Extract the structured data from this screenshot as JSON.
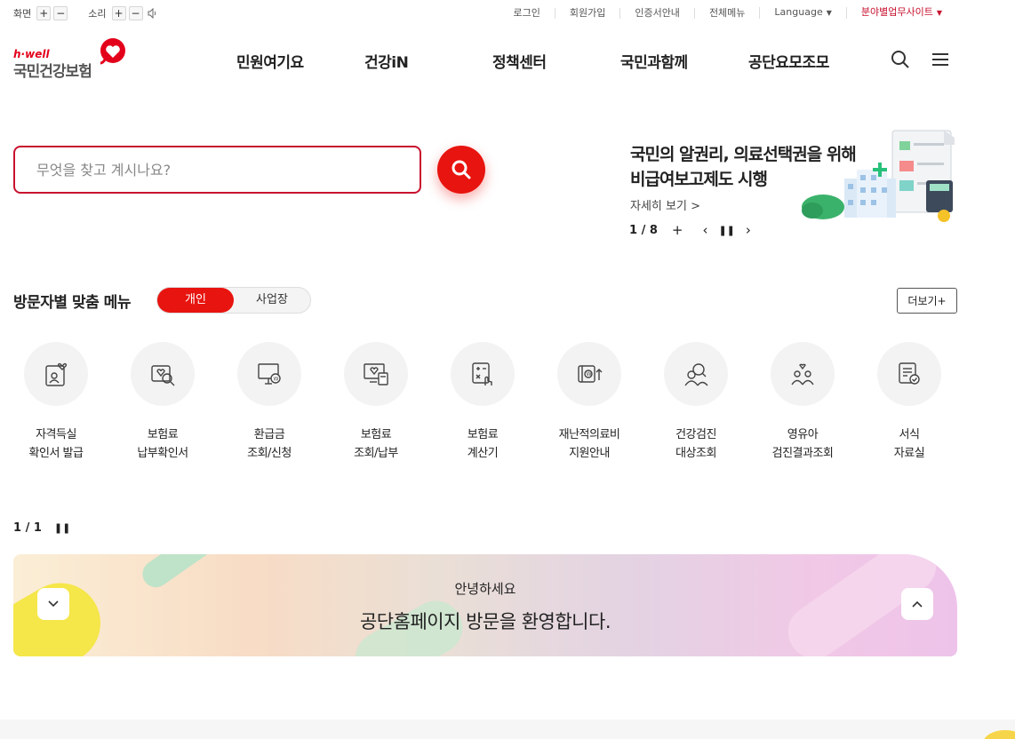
{
  "util": {
    "screen_label": "화면",
    "sound_label": "소리",
    "plus": "+",
    "minus": "−",
    "links": [
      "로그인",
      "회원가입",
      "인증서안내",
      "전체메뉴"
    ],
    "language": "Language",
    "field_site": "분야별업무사이트"
  },
  "logo": {
    "brand": "h·well",
    "name": "국민건강보험"
  },
  "gnb": [
    "민원여기요",
    "건강iN",
    "정책센터",
    "국민과함께",
    "공단요모조모"
  ],
  "search": {
    "placeholder": "무엇을 찾고 계시나요?"
  },
  "banner": {
    "title_line1": "국민의 알권리, 의료선택권을 위해",
    "title_line2": "비급여보고제도 시행",
    "more": "자세히 보기 >",
    "counter": "1 / 8"
  },
  "visitor": {
    "title": "방문자별 맞춤 메뉴",
    "tab_personal": "개인",
    "tab_business": "사업장",
    "more": "더보기+"
  },
  "quick_menu": [
    {
      "line1": "자격득실",
      "line2": "확인서 발급",
      "icon": "id-card-heart-icon"
    },
    {
      "line1": "보험료",
      "line2": "납부확인서",
      "icon": "heart-search-icon"
    },
    {
      "line1": "환급금",
      "line2": "조회/신청",
      "icon": "monitor-won-icon"
    },
    {
      "line1": "보험료",
      "line2": "조회/납부",
      "icon": "screen-heart-card-icon"
    },
    {
      "line1": "보험료",
      "line2": "계산기",
      "icon": "calculator-hand-icon"
    },
    {
      "line1": "재난적의료비",
      "line2": "지원안내",
      "icon": "book-won-icon"
    },
    {
      "line1": "건강검진",
      "line2": "대상조회",
      "icon": "people-search-icon"
    },
    {
      "line1": "영유아",
      "line2": "검진결과조회",
      "icon": "family-heart-icon"
    },
    {
      "line1": "서식",
      "line2": "자료실",
      "icon": "document-check-icon"
    }
  ],
  "quick_pager": "1 / 1",
  "welcome": {
    "hello": "안녕하세요",
    "message": "공단홈페이지 방문을 환영합니다."
  },
  "colors": {
    "accent": "#e8140f",
    "brand_red": "#c8102e"
  }
}
